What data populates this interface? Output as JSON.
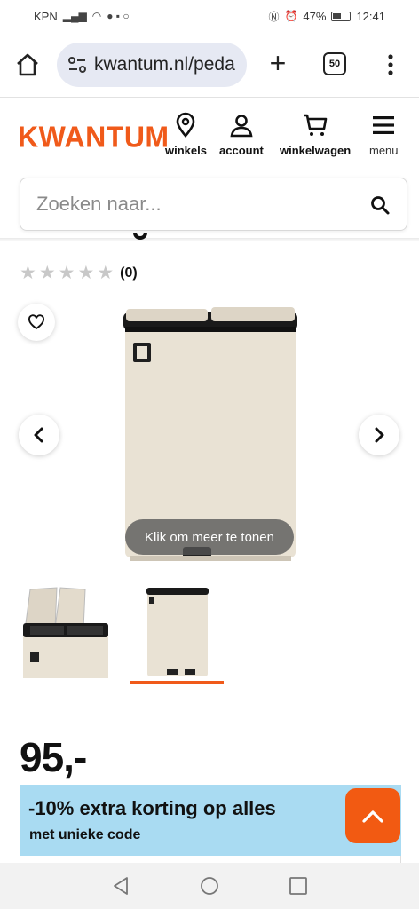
{
  "status_bar": {
    "carrier": "KPN",
    "battery": "47%",
    "time": "12:41"
  },
  "browser": {
    "url": "kwantum.nl/peda",
    "tab_count": "50"
  },
  "site": {
    "logo": "KWANTUM",
    "nav": {
      "stores": "winkels",
      "account": "account",
      "cart": "winkelwagen",
      "menu": "menu"
    },
    "search_placeholder": "Zoeken naar..."
  },
  "product": {
    "rating_count": "(0)",
    "stars": 5,
    "rating_value": 0,
    "gallery_hint": "Klik om meer te tonen",
    "price": "95,-",
    "thumbnails": [
      {
        "name": "open-bins-view"
      },
      {
        "name": "closed-bins-view",
        "active": true
      }
    ]
  },
  "promo": {
    "title": "-10% extra korting op alles",
    "subtitle": "met unieke code"
  },
  "colors": {
    "brand_orange": "#f05a1a",
    "promo_blue": "#a9dbf2",
    "product_beige": "#e9e2d4"
  },
  "icons": [
    "home-icon",
    "site-info-icon",
    "plus-icon",
    "more-vert-icon",
    "location-pin-icon",
    "person-icon",
    "cart-icon",
    "hamburger-icon",
    "search-icon",
    "star-icon",
    "heart-icon",
    "chevron-left-icon",
    "chevron-right-icon",
    "chevron-up-icon",
    "back-icon",
    "home-circle-icon",
    "recents-icon"
  ]
}
